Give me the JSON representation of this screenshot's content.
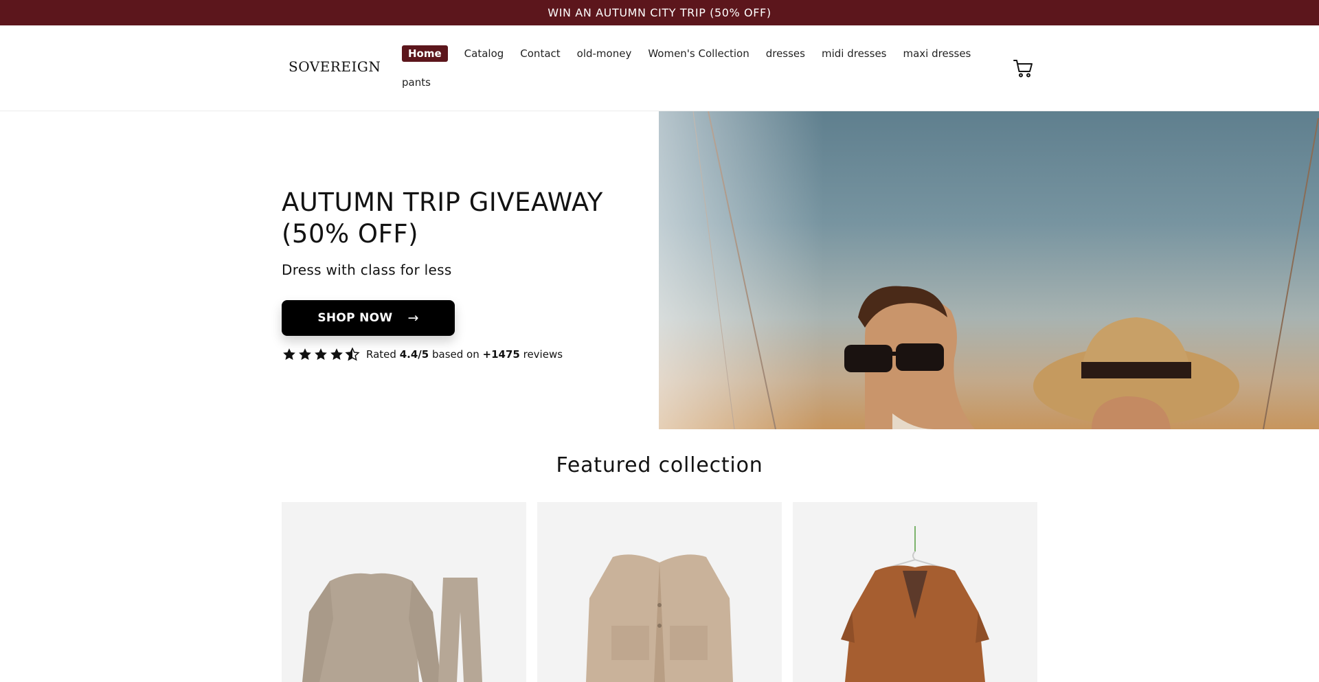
{
  "announcement": "WIN AN AUTUMN CITY TRIP (50% OFF)",
  "header": {
    "logo": "SOVEREIGN",
    "nav": [
      {
        "label": "Home",
        "active": true
      },
      {
        "label": "Catalog"
      },
      {
        "label": "Contact"
      },
      {
        "label": "old-money"
      },
      {
        "label": "Women's Collection"
      },
      {
        "label": "dresses"
      },
      {
        "label": "midi dresses"
      },
      {
        "label": "maxi dresses"
      },
      {
        "label": "pants"
      }
    ],
    "cart_icon": "cart-icon"
  },
  "hero": {
    "title": "AUTUMN TRIP GIVEAWAY (50% OFF)",
    "subtitle": "Dress with class for less",
    "button_label": "SHOP NOW",
    "rating": {
      "stars": 4.5,
      "prefix": "Rated",
      "score": "4.4/5",
      "middle": "based on",
      "count": "+1475",
      "suffix": "reviews"
    }
  },
  "featured": {
    "title": "Featured collection",
    "products": [
      {
        "image": "beige knit sweater and pants set"
      },
      {
        "image": "beige knit cardigan"
      },
      {
        "image": "brown jacket on hanger"
      }
    ]
  },
  "colors": {
    "brand": "#5c161c",
    "button": "#000000"
  }
}
